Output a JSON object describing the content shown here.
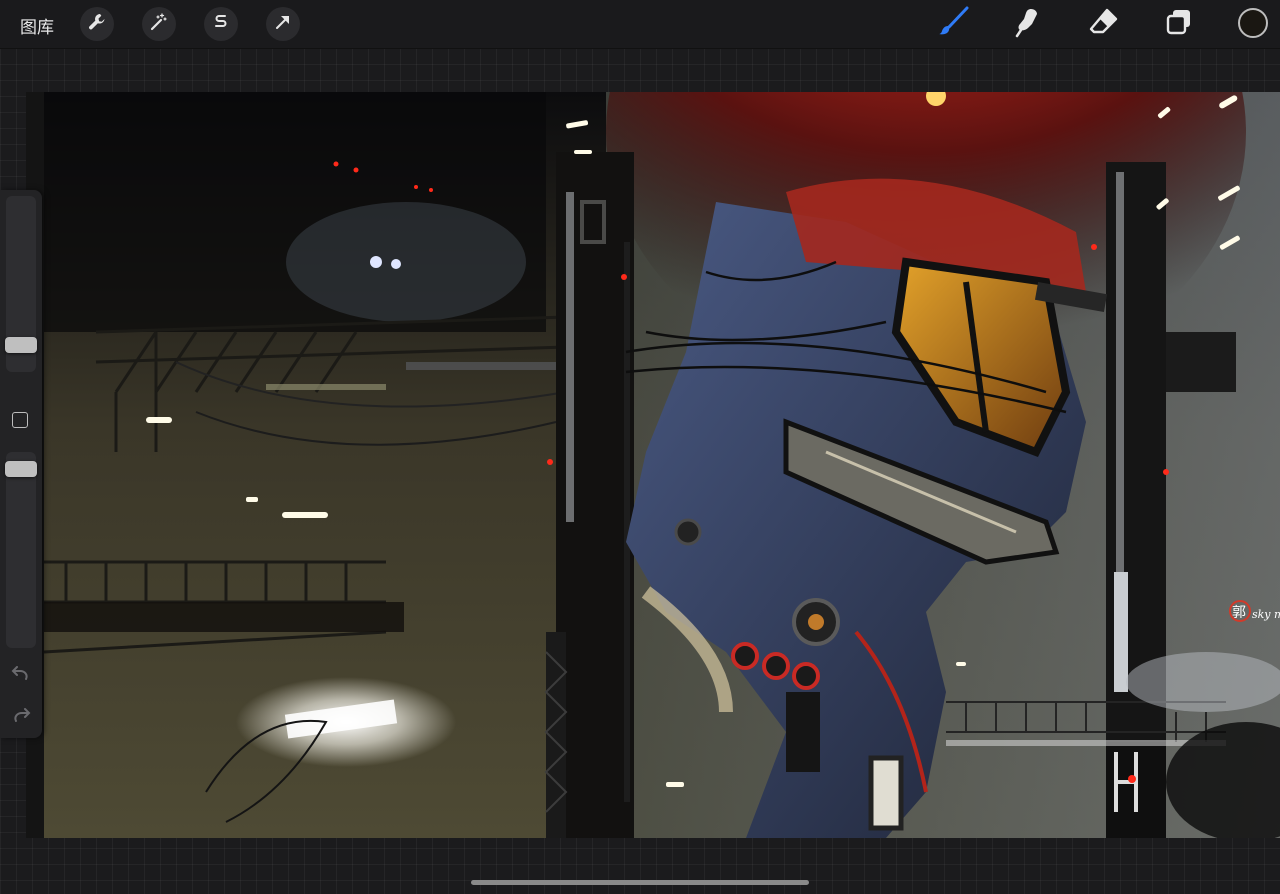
{
  "toolbar": {
    "gallery_label": "图库",
    "actions_icon": "wrench-icon",
    "adjustments_icon": "magic-wand-icon",
    "selection_icon": "selection-s-icon",
    "transform_icon": "arrow-cursor-icon",
    "brush_icon": "brush-icon",
    "smudge_icon": "smudge-icon",
    "eraser_icon": "eraser-icon",
    "layers_icon": "layers-icon",
    "active_tool": "brush",
    "active_color": "#1a1712",
    "accent_color": "#2f7bf6"
  },
  "sidebar": {
    "brush_size": 0.12,
    "brush_opacity": 0.95,
    "modify_icon": "square-icon",
    "undo_icon": "undo-icon",
    "redo_icon": "redo-icon"
  },
  "canvas": {
    "artwork": "painting",
    "signature": "郭 sky m"
  }
}
